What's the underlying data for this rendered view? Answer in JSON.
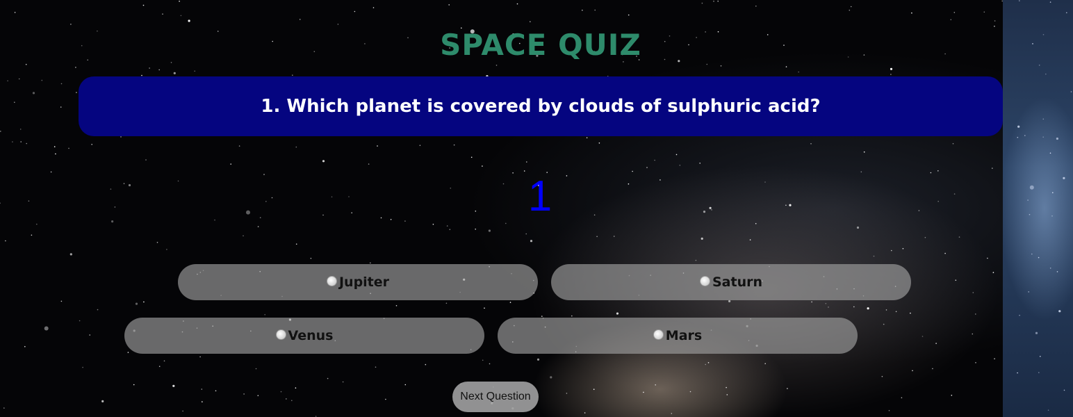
{
  "quiz": {
    "title": "SPACE QUIZ",
    "question": "1. Which planet is covered by clouds of sulphuric acid?",
    "counter": "1",
    "options": [
      {
        "label": "Jupiter"
      },
      {
        "label": "Saturn"
      },
      {
        "label": "Venus"
      },
      {
        "label": "Mars"
      }
    ],
    "next_label": "Next Question"
  },
  "colors": {
    "title": "#2e8b6b",
    "question_bg": "#050580",
    "counter": "#0000ff",
    "option_bg": "rgba(160,160,160,0.65)"
  }
}
